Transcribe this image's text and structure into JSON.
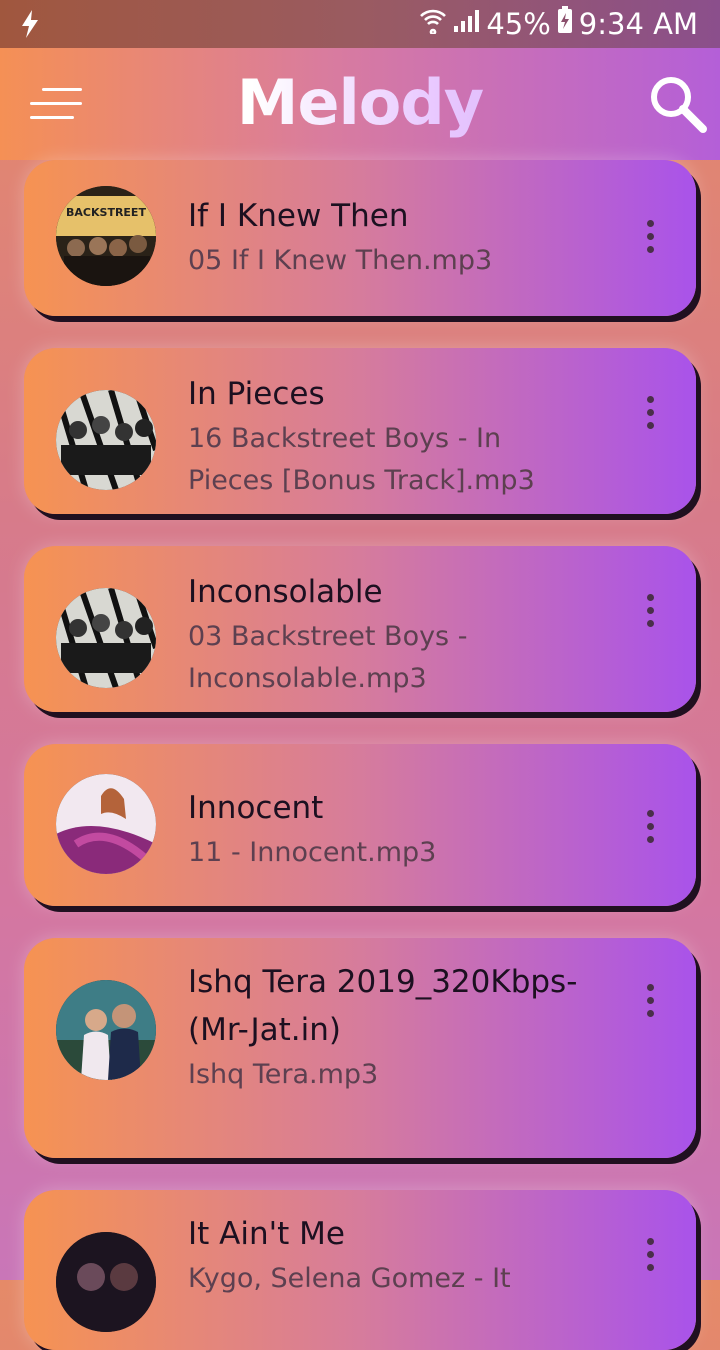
{
  "status_bar": {
    "battery": "45%",
    "time": "9:34 AM"
  },
  "app": {
    "title": "Melody"
  },
  "songs": [
    {
      "title": "If I Knew Then",
      "file": "05 If I Knew Then.mp3",
      "art": "backstreet-boys-this-is-us"
    },
    {
      "title": "In Pieces",
      "file": "16  Backstreet Boys - In Pieces [Bonus Track].mp3",
      "art": "backstreet-boys-in-a-world"
    },
    {
      "title": "Inconsolable",
      "file": "03  Backstreet Boys - Inconsolable.mp3",
      "art": "backstreet-boys-in-a-world"
    },
    {
      "title": "Innocent",
      "file": "11 - Innocent.mp3",
      "art": "speak-now"
    },
    {
      "title": "Ishq Tera 2019_320Kbps-(Mr-Jat.in)",
      "file": "Ishq Tera.mp3",
      "art": "ishq-tera"
    },
    {
      "title": "It Ain't Me",
      "file": "Kygo, Selena Gomez - It",
      "art": "it-aint-me"
    }
  ]
}
